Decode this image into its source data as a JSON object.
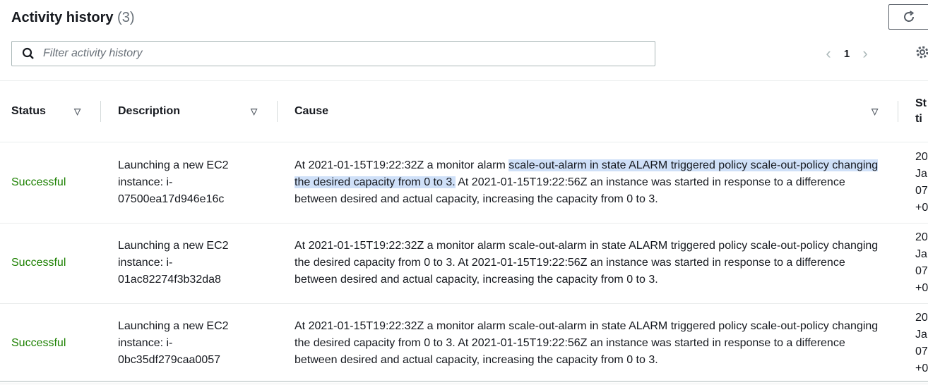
{
  "header": {
    "title": "Activity history",
    "count": "(3)"
  },
  "toolbar": {
    "search_placeholder": "Filter activity history",
    "page_current": "1"
  },
  "table": {
    "columns": [
      "Status",
      "Description",
      "Cause",
      "St ti"
    ],
    "rows": [
      {
        "status": "Successful",
        "description": "Launching a new EC2 instance: i-07500ea17d946e16c",
        "cause_before": "At 2021-01-15T19:22:32Z a monitor alarm ",
        "cause_highlight": "scale-out-alarm in state ALARM triggered policy scale-out-policy changing the desired capacity from 0 to 3.",
        "cause_after": " At 2021-01-15T19:22:56Z an instance was started in response to a difference between desired and actual capacity, increasing the capacity from 0 to 3.",
        "start_lines": [
          "20",
          "Ja",
          "07",
          "+0"
        ]
      },
      {
        "status": "Successful",
        "description": "Launching a new EC2 instance: i-01ac82274f3b32da8",
        "cause_before": "At 2021-01-15T19:22:32Z a monitor alarm scale-out-alarm in state ALARM triggered policy scale-out-policy changing the desired capacity from 0 to 3. At 2021-01-15T19:22:56Z an instance was started in response to a difference between desired and actual capacity, increasing the capacity from 0 to 3.",
        "cause_highlight": "",
        "cause_after": "",
        "start_lines": [
          "20",
          "Ja",
          "07",
          "+0"
        ]
      },
      {
        "status": "Successful",
        "description": "Launching a new EC2 instance: i-0bc35df279caa0057",
        "cause_before": "At 2021-01-15T19:22:32Z a monitor alarm scale-out-alarm in state ALARM triggered policy scale-out-policy changing the desired capacity from 0 to 3. At 2021-01-15T19:22:56Z an instance was started in response to a difference between desired and actual capacity, increasing the capacity from 0 to 3.",
        "cause_highlight": "",
        "cause_after": "",
        "start_lines": [
          "20",
          "Ja",
          "07",
          "+0"
        ]
      }
    ]
  },
  "colors": {
    "success": "#1d8102",
    "highlight": "#cfe0f8",
    "muted": "#687078"
  }
}
